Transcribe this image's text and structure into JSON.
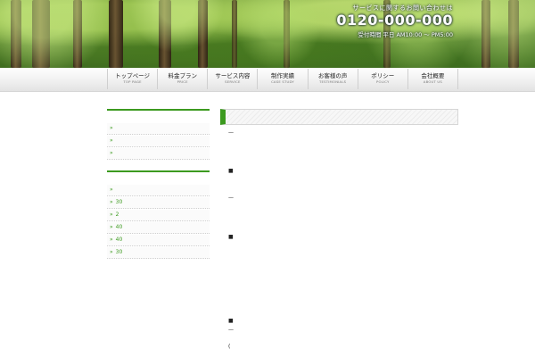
{
  "header": {
    "lead": "サービスに関するお問い合わせは",
    "phone": "0120-000-000",
    "hours": "受付時間 平日 AM10:00 ～ PM5:00"
  },
  "nav": {
    "items": [
      {
        "jp": "トップページ",
        "en": "TOP PAGE"
      },
      {
        "jp": "料金プラン",
        "en": "PRICE"
      },
      {
        "jp": "サービス内容",
        "en": "SERVICE"
      },
      {
        "jp": "制作実績",
        "en": "CASE STUDY"
      },
      {
        "jp": "お客様の声",
        "en": "TESTIMONIALS"
      },
      {
        "jp": "ポリシー",
        "en": "POLICY"
      },
      {
        "jp": "会社概要",
        "en": "ABOUT US"
      }
    ]
  },
  "sidebar": {
    "list1": [
      {
        "arrow": "»",
        "text": ""
      },
      {
        "arrow": "»",
        "text": ""
      },
      {
        "arrow": "»",
        "text": ""
      }
    ],
    "list2": [
      {
        "arrow": "»",
        "text": ""
      },
      {
        "arrow": "»",
        "text": "30"
      },
      {
        "arrow": "»",
        "text": "2"
      },
      {
        "arrow": "»",
        "text": "40"
      },
      {
        "arrow": "»",
        "text": "40"
      },
      {
        "arrow": "»",
        "text": "30"
      }
    ]
  },
  "main": {
    "marks": [
      "—",
      "■",
      "—",
      "■",
      "■",
      "—",
      "("
    ]
  }
}
